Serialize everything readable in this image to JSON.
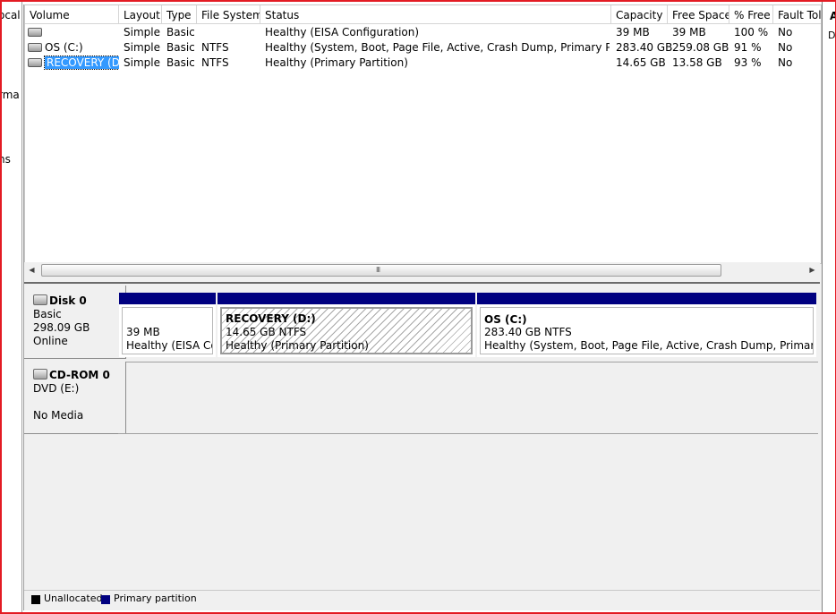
{
  "left_pane": {
    "texts": [
      "ocal",
      "rma",
      "ns"
    ]
  },
  "right_pane": {
    "texts": [
      "A",
      "D"
    ]
  },
  "columns": [
    "Volume",
    "Layout",
    "Type",
    "File System",
    "Status",
    "Capacity",
    "Free Space",
    "% Free",
    "Fault Tol"
  ],
  "volumes": [
    {
      "volume": "",
      "layout": "Simple",
      "type": "Basic",
      "fs": "",
      "status": "Healthy (EISA Configuration)",
      "capacity": "39 MB",
      "free": "39 MB",
      "pct": "100 %",
      "fault": "No"
    },
    {
      "volume": "OS (C:)",
      "layout": "Simple",
      "type": "Basic",
      "fs": "NTFS",
      "status": "Healthy (System, Boot, Page File, Active, Crash Dump, Primary Partition)",
      "capacity": "283.40 GB",
      "free": "259.08 GB",
      "pct": "91 %",
      "fault": "No"
    },
    {
      "volume": "RECOVERY (D:)",
      "layout": "Simple",
      "type": "Basic",
      "fs": "NTFS",
      "status": "Healthy (Primary Partition)",
      "capacity": "14.65 GB",
      "free": "13.58 GB",
      "pct": "93 %",
      "fault": "No",
      "selected": true
    }
  ],
  "scroll": {
    "grip": "III"
  },
  "disks": [
    {
      "name": "Disk 0",
      "type": "Basic",
      "size": "298.09 GB",
      "state": "Online",
      "partitions": [
        {
          "title": "",
          "size": "39 MB",
          "status": "Healthy (EISA Con"
        },
        {
          "title": "RECOVERY  (D:)",
          "size": "14.65 GB NTFS",
          "status": "Healthy (Primary Partition)"
        },
        {
          "title": "OS  (C:)",
          "size": "283.40 GB NTFS",
          "status": "Healthy (System, Boot, Page File, Active, Crash Dump, Primary Partiti"
        }
      ]
    },
    {
      "name": "CD-ROM 0",
      "type": "DVD (E:)",
      "media": "No Media"
    }
  ],
  "legend": [
    {
      "label": "Unallocated",
      "color": "#000000"
    },
    {
      "label": "Primary partition",
      "color": "#000080"
    }
  ]
}
